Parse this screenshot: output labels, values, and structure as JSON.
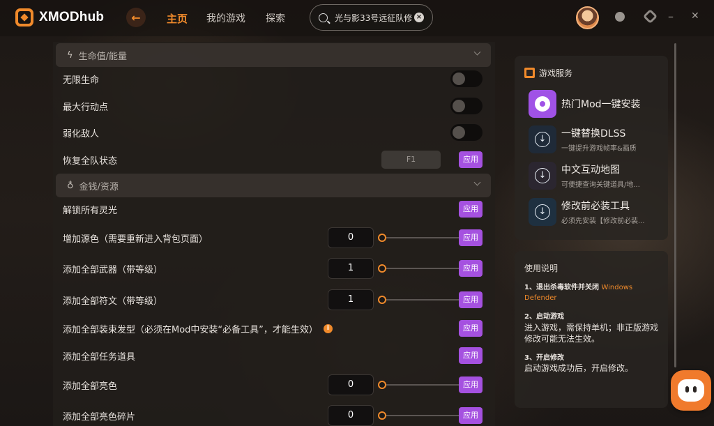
{
  "app": {
    "name": "XMODhub"
  },
  "nav": {
    "home": "主页",
    "my_games": "我的游戏",
    "explore": "探索"
  },
  "search": {
    "value": "光与影33号远征队修"
  },
  "colors": {
    "accent": "#f08a2b",
    "apply": "#a551e0"
  },
  "sections": [
    {
      "title": "生命值/能量",
      "icon": "lightning-icon",
      "rows": [
        {
          "label": "无限生命",
          "control": "toggle"
        },
        {
          "label": "最大行动点",
          "control": "toggle"
        },
        {
          "label": "弱化敌人",
          "control": "toggle"
        },
        {
          "label": "恢复全队状态",
          "control": "hotkey",
          "hotkey": "F1",
          "apply": "应用"
        }
      ]
    },
    {
      "title": "金钱/资源",
      "icon": "money-bag-icon",
      "rows": [
        {
          "label": "解锁所有灵光",
          "apply": "应用"
        },
        {
          "label": "增加源色（需要重新进入背包页面）",
          "value": "0",
          "apply": "应用"
        },
        {
          "label": "添加全部武器（带等级）",
          "value": "1",
          "apply": "应用"
        },
        {
          "label": "添加全部符文（带等级）",
          "value": "1",
          "apply": "应用"
        },
        {
          "label": "添加全部装束发型（必须在Mod中安装“必备工具”，才能生效）",
          "info": "i",
          "apply": "应用"
        },
        {
          "label": "添加全部任务道具",
          "apply": "应用"
        },
        {
          "label": "添加全部亮色",
          "value": "0",
          "apply": "应用"
        },
        {
          "label": "添加全部亮色碎片",
          "value": "0",
          "apply": "应用"
        }
      ]
    }
  ],
  "services": {
    "title": "游戏服务",
    "items": [
      {
        "name": "热门Mod一键安装",
        "sub": ""
      },
      {
        "name": "一键替换DLSS",
        "sub": "一键提升游戏帧率&画质"
      },
      {
        "name": "中文互动地图",
        "sub": "可便捷查询关键道具/地..."
      },
      {
        "name": "修改前必装工具",
        "sub": "必须先安装【修改前必装..."
      }
    ]
  },
  "usage": {
    "title": "使用说明",
    "step1_head": "1、退出杀毒软件并关闭",
    "step1_highlight": "Windows Defender",
    "step2_head": "2、启动游戏",
    "step2_body": "进入游戏，需保持单机；非正版游戏修改可能无法生效。",
    "step3_head": "3、开启修改",
    "step3_body": "启动游戏成功后，开启修改。"
  }
}
